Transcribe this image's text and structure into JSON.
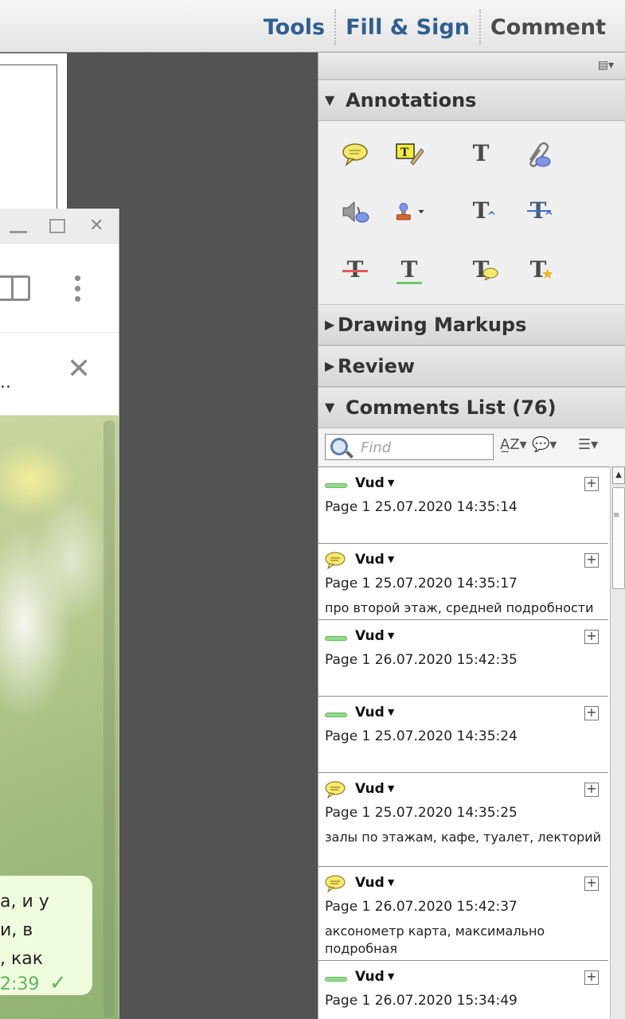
{
  "toolbar": {
    "tabs": [
      {
        "label": "Tools"
      },
      {
        "label": "Fill & Sign"
      },
      {
        "label": "Comment"
      }
    ]
  },
  "chat_window": {
    "notice_text": "..",
    "message_lines": [
      "а, и у",
      "и, в",
      ", как"
    ],
    "message_time": "2:39"
  },
  "panel": {
    "annotations_title": "Annotations",
    "drawing_markups_title": "Drawing Markups",
    "review_title": "Review",
    "comments_list_title": "Comments List (76)",
    "find_placeholder": "Find",
    "annotation_tools": [
      "sticky-note",
      "highlight-text",
      "add-text-box",
      "attach-file",
      "record-audio",
      "add-stamp",
      "insert-text",
      "replace-text",
      "strikethrough",
      "underline",
      "add-note-to-text",
      "text-correction"
    ]
  },
  "comments": [
    {
      "type": "highlight",
      "author": "Vud",
      "meta": "Page 1  25.07.2020 14:35:14",
      "text": ""
    },
    {
      "type": "note",
      "author": "Vud",
      "meta": "Page 1  25.07.2020 14:35:17",
      "text": "про второй этаж, средней подробности"
    },
    {
      "type": "highlight",
      "author": "Vud",
      "meta": "Page 1  26.07.2020 15:42:35",
      "text": ""
    },
    {
      "type": "highlight",
      "author": "Vud",
      "meta": "Page 1  25.07.2020 14:35:24",
      "text": ""
    },
    {
      "type": "note",
      "author": "Vud",
      "meta": "Page 1  25.07.2020 14:35:25",
      "text": "залы по этажам, кафе, туалет, лекторий"
    },
    {
      "type": "note",
      "author": "Vud",
      "meta": "Page 1  26.07.2020 15:42:37",
      "text": "аксонометр карта, максимально подробная"
    },
    {
      "type": "highlight",
      "author": "Vud",
      "meta": "Page 1  26.07.2020 15:34:49",
      "text": ""
    }
  ],
  "colors": {
    "tab_blue": "#2f5f8f",
    "highlight_green": "#8fdc8a",
    "note_yellow": "#f7e96a",
    "chat_bubble": "#effdde",
    "chat_time_green": "#5fb35a"
  }
}
